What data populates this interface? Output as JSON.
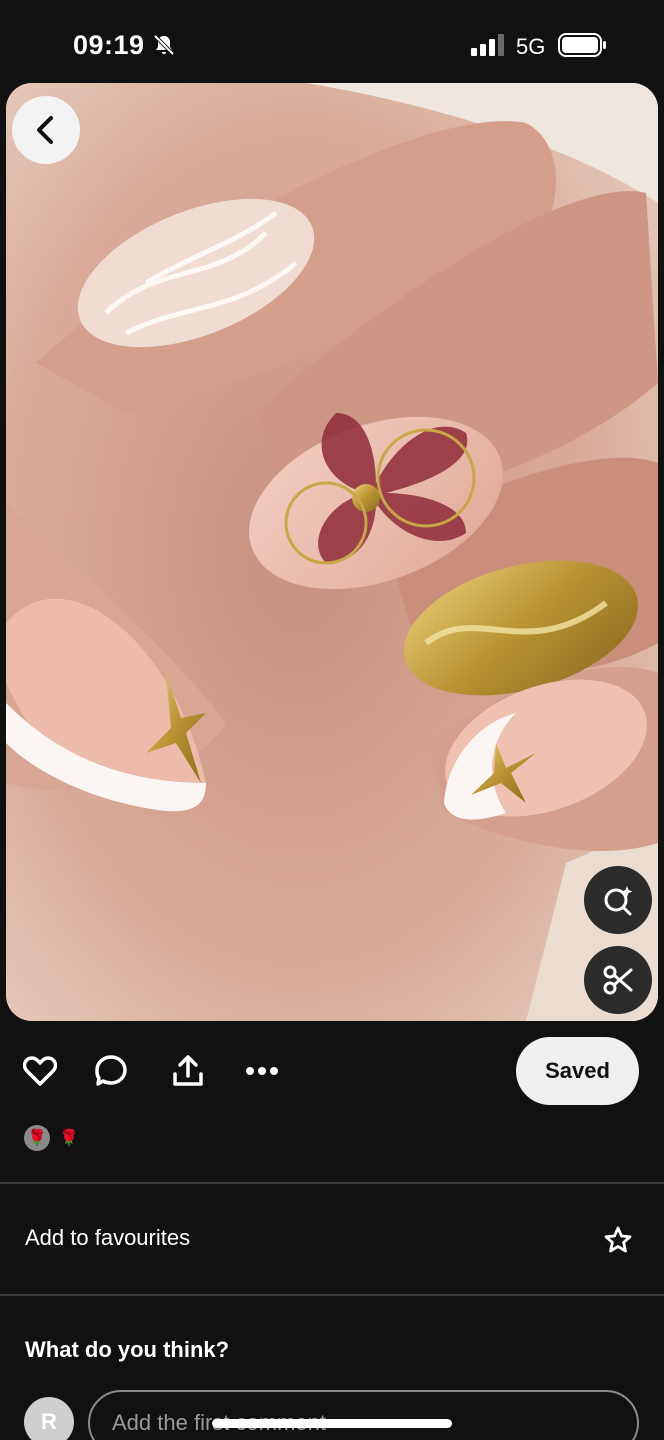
{
  "status_bar": {
    "time": "09:19",
    "network": "5G",
    "icons": [
      "bell-off-icon",
      "signal-icon",
      "battery-icon"
    ]
  },
  "pin": {
    "image_icon": "nail-art-photo",
    "back_icon": "chevron-left-icon",
    "lens_icon": "visual-search-icon",
    "cutout_icon": "scissors-icon"
  },
  "actions": {
    "icons": [
      "heart-icon",
      "comment-icon",
      "share-icon",
      "more-icon"
    ],
    "saved_label": "Saved"
  },
  "reactions": [
    "🌹",
    "🌹"
  ],
  "favourites": {
    "label": "Add to favourites",
    "icon": "star-icon"
  },
  "comments": {
    "heading": "What do you think?",
    "avatar_initial": "R",
    "placeholder": "Add the first comment"
  },
  "colors": {
    "background": "#111111",
    "saved_button": "#efefef",
    "divider": "#3a3a3a"
  }
}
